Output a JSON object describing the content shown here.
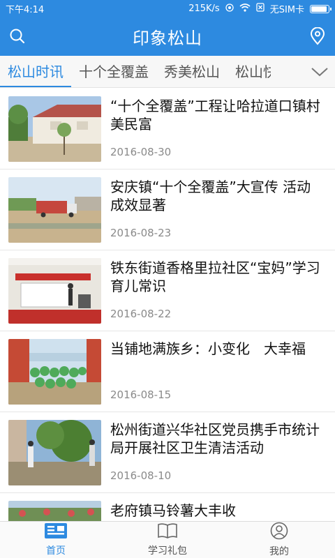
{
  "status": {
    "time": "下午4:14",
    "speed": "215K/s",
    "sim": "无SIM卡"
  },
  "header": {
    "title": "印象松山",
    "left_icon": "search-icon",
    "right_icon": "location-pin-icon"
  },
  "tabs": [
    {
      "label": "松山时讯",
      "active": true
    },
    {
      "label": "十个全覆盖",
      "active": false
    },
    {
      "label": "秀美松山",
      "active": false
    },
    {
      "label": "松山快",
      "active": false
    }
  ],
  "tabs_more_icon": "chevron-down-icon",
  "articles": [
    {
      "title": "“十个全覆盖”工程让哈拉道口镇村美民富",
      "date": "2016-08-30"
    },
    {
      "title": "安庆镇“十个全覆盖”大宣传 活动成效显著",
      "date": "2016-08-23"
    },
    {
      "title": "铁东街道香格里拉社区“宝妈”学习育儿常识",
      "date": "2016-08-22"
    },
    {
      "title": "当铺地满族乡：小变化　大幸福",
      "date": "2016-08-15"
    },
    {
      "title": "松州街道兴华社区党员携手市统计局开展社区卫生清洁活动",
      "date": "2016-08-10"
    },
    {
      "title": "老府镇马铃薯大丰收",
      "date": ""
    }
  ],
  "bottom_nav": [
    {
      "label": "首页",
      "icon": "news-icon",
      "active": true
    },
    {
      "label": "学习礼包",
      "icon": "book-icon",
      "active": false
    },
    {
      "label": "我的",
      "icon": "user-icon",
      "active": false
    }
  ],
  "colors": {
    "primary": "#2d8ae0",
    "text": "#111111",
    "muted": "#8a8a8a"
  }
}
